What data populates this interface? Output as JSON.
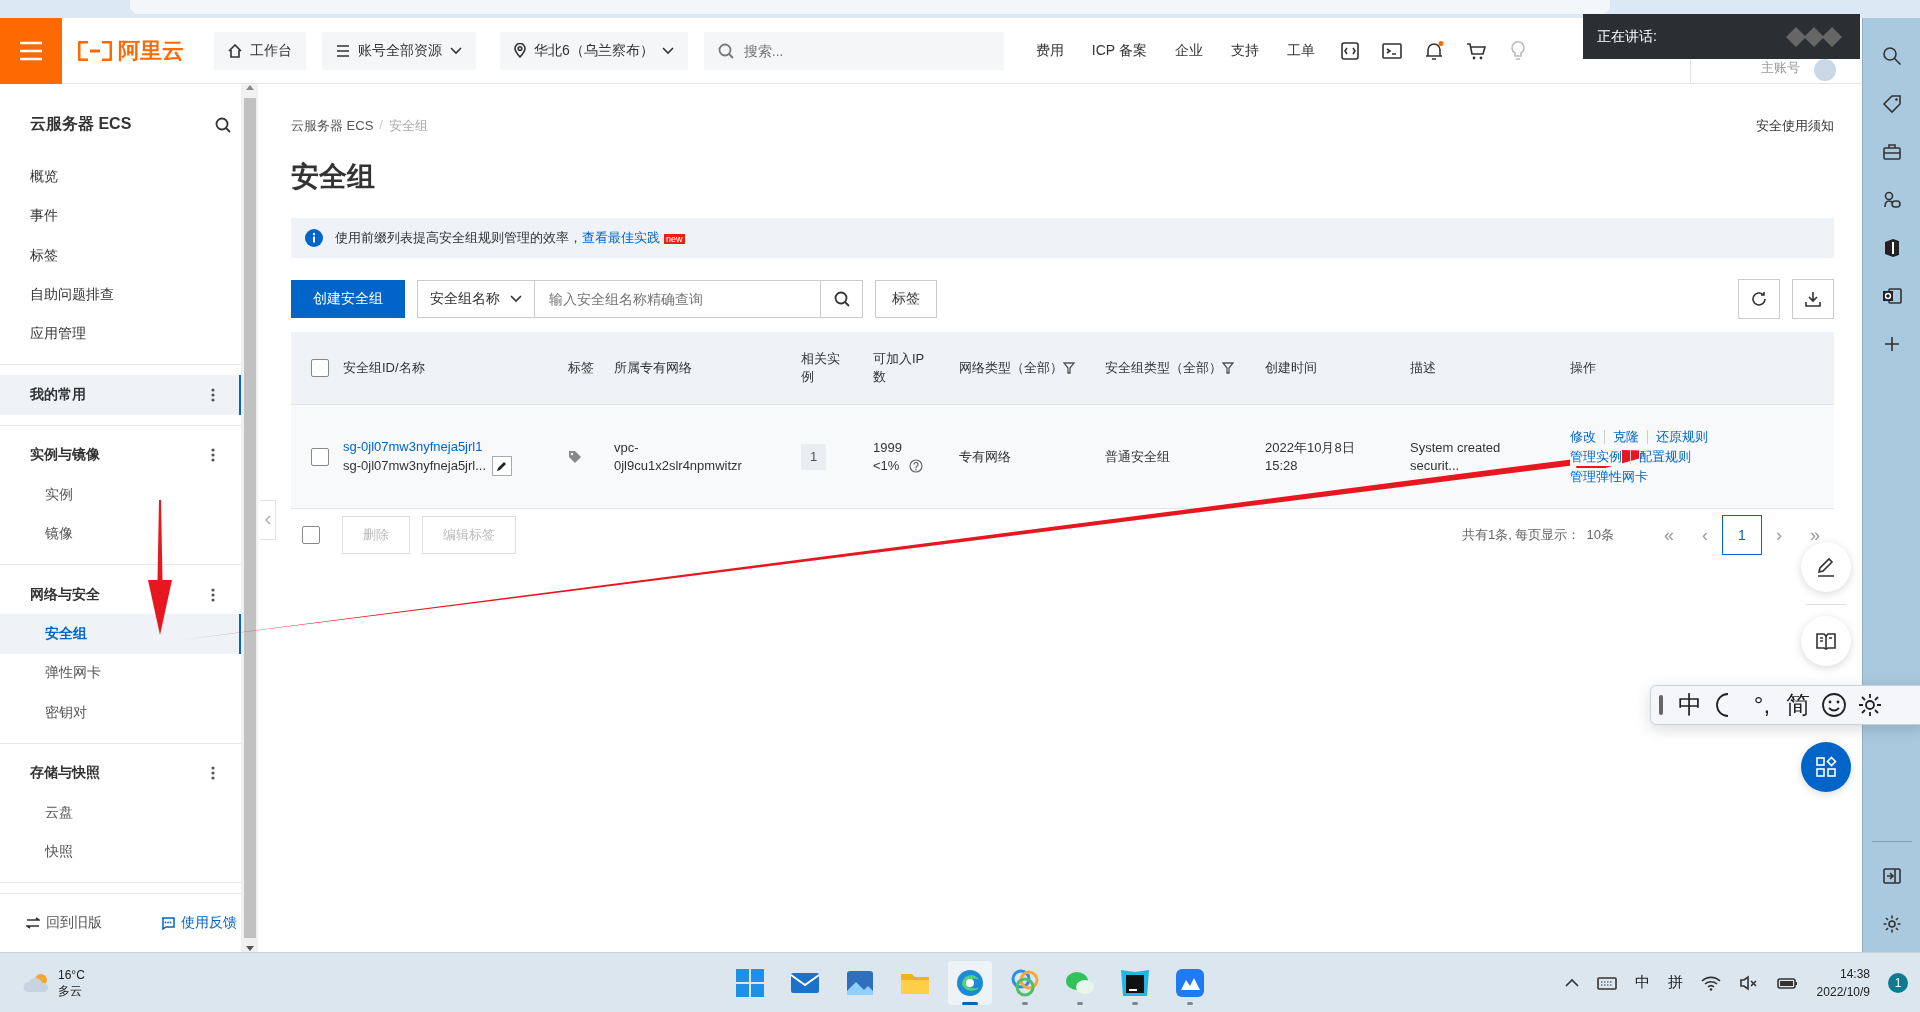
{
  "header": {
    "logo": "阿里云",
    "workbench": "工作台",
    "resources": "账号全部资源",
    "region": "华北6（乌兰察布）",
    "search": {
      "placeholder": "搜索..."
    },
    "links": [
      "费用",
      "ICP 备案",
      "企业",
      "支持",
      "工单"
    ],
    "account": "主账号"
  },
  "speaking_overlay": {
    "label": "正在讲话:"
  },
  "sidebar": {
    "title": "云服务器 ECS",
    "items": [
      {
        "label": "概览",
        "selected": false
      },
      {
        "label": "事件",
        "selected": false
      },
      {
        "label": "标签",
        "selected": false
      },
      {
        "label": "自助问题排查",
        "selected": false
      },
      {
        "label": "应用管理",
        "selected": false
      }
    ],
    "groups": [
      {
        "label": "我的常用",
        "selected": true
      },
      {
        "label": "实例与镜像",
        "selected": false,
        "children": [
          {
            "label": "实例",
            "selected": false
          },
          {
            "label": "镜像",
            "selected": false
          }
        ]
      },
      {
        "label": "网络与安全",
        "selected": false,
        "children": [
          {
            "label": "安全组",
            "selected": true
          },
          {
            "label": "弹性网卡",
            "selected": false
          },
          {
            "label": "密钥对",
            "selected": false
          }
        ]
      },
      {
        "label": "存储与快照",
        "selected": false,
        "children": [
          {
            "label": "云盘",
            "selected": false
          },
          {
            "label": "快照",
            "selected": false
          }
        ]
      }
    ],
    "footer": {
      "back": "回到旧版",
      "feedback": "使用反馈"
    }
  },
  "breadcrumb": [
    "云服务器 ECS",
    "安全组"
  ],
  "breadcrumb_separator": "/",
  "help_link": "安全使用须知",
  "page_title": "安全组",
  "notice": {
    "text": "使用前缀列表提高安全组规则管理的效率，",
    "link": "查看最佳实践",
    "badge": "new"
  },
  "toolbar": {
    "create_button": "创建安全组",
    "filter_select": "安全组名称",
    "search": {
      "placeholder": "输入安全组名称精确查询"
    },
    "tag_button": "标签"
  },
  "table": {
    "select_all_checked": false,
    "columns": [
      {
        "label": "安全组ID/名称",
        "filter": false
      },
      {
        "label": "标签",
        "filter": false
      },
      {
        "label": "所属专有网络",
        "filter": false
      },
      {
        "label": "相关实例",
        "filter": false
      },
      {
        "label": "可加入IP数",
        "filter": false
      },
      {
        "label": "网络类型（全部）",
        "filter": true
      },
      {
        "label": "安全组类型（全部）",
        "filter": true
      },
      {
        "label": "创建时间",
        "filter": false
      },
      {
        "label": "描述",
        "filter": false
      },
      {
        "label": "操作",
        "filter": false
      }
    ],
    "rows": [
      {
        "checked": false,
        "id": "sg-0jl07mw3nyfneja5jrl1",
        "name": "sg-0jl07mw3nyfneja5jrl...",
        "vpc": "vpc-0jl9cu1x2slr4npmwitzr",
        "instances": "1",
        "ip_count": "1999",
        "ip_usage": "<1%",
        "network_type": "专有网络",
        "group_type": "普通安全组",
        "created": "2022年10月8日 15:28",
        "description": "System created securit...",
        "actions": [
          [
            "修改",
            "克隆",
            "还原规则"
          ],
          [
            "管理实例",
            "配置规则"
          ],
          [
            "管理弹性网卡"
          ]
        ]
      }
    ]
  },
  "batch": {
    "checked": false,
    "actions": [
      {
        "label": "删除",
        "disabled": true
      },
      {
        "label": "编辑标签",
        "disabled": true
      }
    ]
  },
  "pagination": {
    "summary": "共有1条, 每页显示：",
    "page_size": "10条",
    "first": "«",
    "prev": "‹",
    "pages": [
      {
        "label": "1",
        "selected": true
      }
    ],
    "next": "›",
    "last": "»"
  },
  "ime_toolbar": {
    "items": [
      {
        "kind": "text",
        "label": "中"
      },
      {
        "kind": "moon"
      },
      {
        "kind": "text",
        "label": "°,"
      },
      {
        "kind": "text",
        "label": "简"
      },
      {
        "kind": "smiley"
      },
      {
        "kind": "gear"
      }
    ]
  },
  "taskbar": {
    "weather": {
      "temperature": "16°C",
      "condition": "多云"
    },
    "apps": [
      {
        "kind": "start",
        "running": false,
        "active": false
      },
      {
        "kind": "mail",
        "running": false,
        "active": false
      },
      {
        "kind": "photos",
        "running": false,
        "active": false
      },
      {
        "kind": "folder",
        "running": false,
        "active": false
      },
      {
        "kind": "browser",
        "running": true,
        "active": true
      },
      {
        "kind": "rings",
        "running": true,
        "active": false
      },
      {
        "kind": "chat",
        "running": true,
        "active": false
      },
      {
        "kind": "ide",
        "running": true,
        "active": false
      },
      {
        "kind": "cloud",
        "running": true,
        "active": false
      }
    ],
    "ime_mode": "中",
    "ime_name": "拼",
    "time": "14:38",
    "date": "2022/10/9",
    "notification_count": "1"
  }
}
